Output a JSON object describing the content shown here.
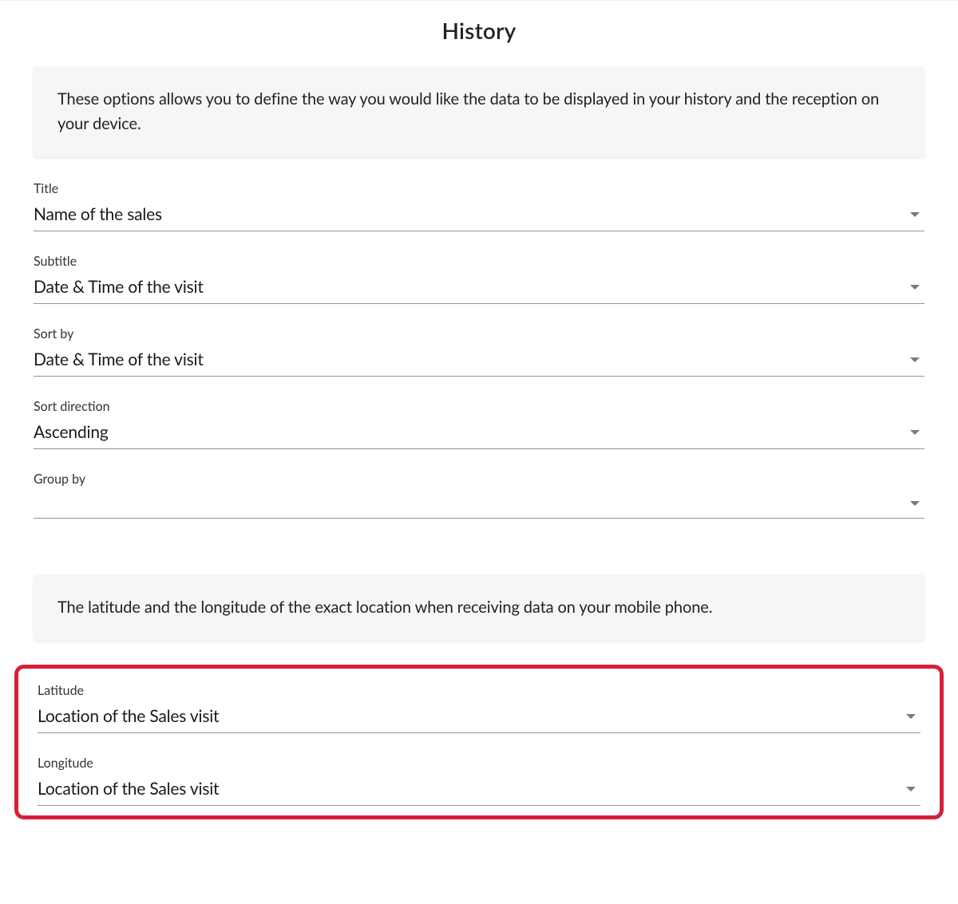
{
  "header": {
    "title": "History"
  },
  "info1": {
    "text": "These options allows you to define the way you would like the data to be displayed in your history and the reception on your device."
  },
  "fields": {
    "title": {
      "label": "Title",
      "value": "Name of the sales"
    },
    "subtitle": {
      "label": "Subtitle",
      "value": "Date & Time of the visit"
    },
    "sortBy": {
      "label": "Sort by",
      "value": "Date & Time of the visit"
    },
    "sortDir": {
      "label": "Sort direction",
      "value": "Ascending"
    },
    "groupBy": {
      "label": "Group by",
      "value": ""
    }
  },
  "info2": {
    "text": "The latitude and the longitude of the exact location when receiving data on your mobile phone."
  },
  "locationFields": {
    "latitude": {
      "label": "Latitude",
      "value": "Location of the Sales visit"
    },
    "longitude": {
      "label": "Longitude",
      "value": "Location of the Sales visit"
    }
  }
}
